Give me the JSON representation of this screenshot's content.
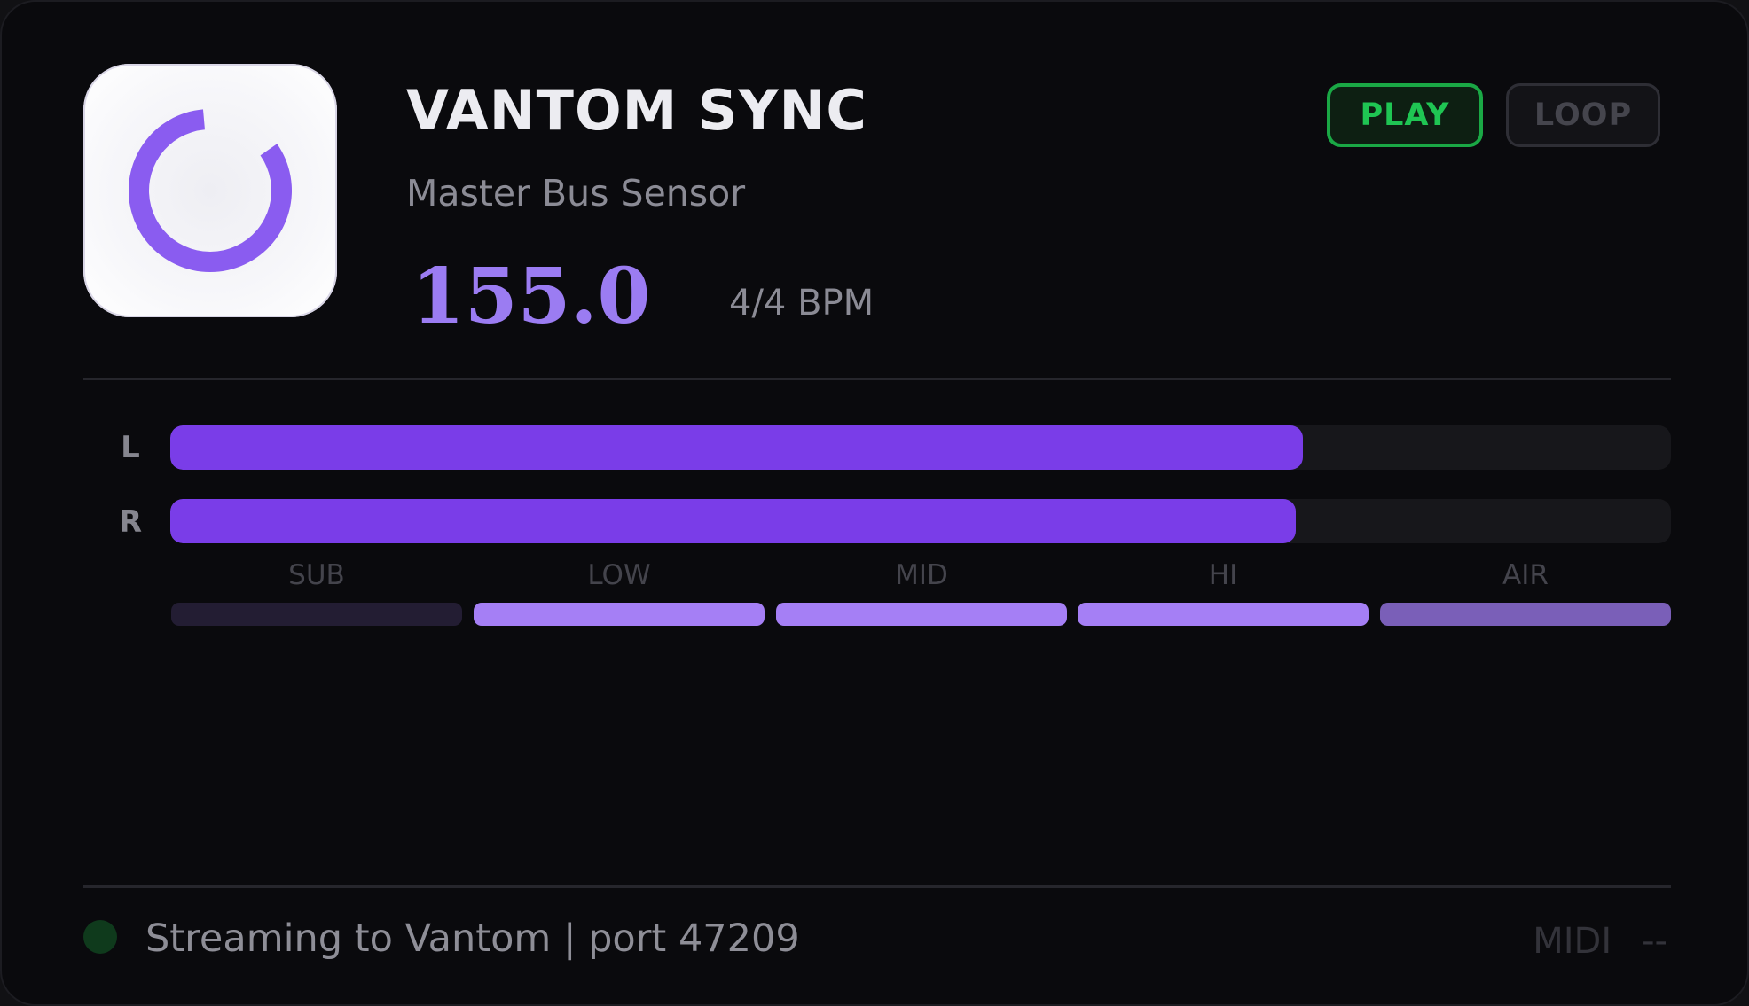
{
  "app": {
    "title": "VANTOM SYNC",
    "subtitle": "Master Bus Sensor",
    "icon": "vantom-ring-logo"
  },
  "tempo": {
    "bpm": "155.0",
    "unit": "4/4 BPM"
  },
  "transport": {
    "play_label": "PLAY",
    "loop_label": "LOOP",
    "play_active": true,
    "loop_active": false
  },
  "meters": {
    "left_label": "L",
    "right_label": "R",
    "left_level": 0.755,
    "right_level": 0.75,
    "fill_color": "#7a3de8"
  },
  "bands": [
    {
      "label": "SUB",
      "level": "low",
      "color": "#231d33"
    },
    {
      "label": "LOW",
      "level": "high",
      "color": "#a57ff5"
    },
    {
      "label": "MID",
      "level": "high",
      "color": "#a57ff5"
    },
    {
      "label": "HI",
      "level": "high",
      "color": "#a57ff5"
    },
    {
      "label": "AIR",
      "level": "medium",
      "color": "#7a5fb8"
    }
  ],
  "status": {
    "text": "Streaming to Vantom  |  port 47209",
    "indicator_color": "#0f3a1c",
    "midi_label": "MIDI",
    "midi_value": "--"
  },
  "colors": {
    "accent": "#9b7cf2",
    "play": "#1fc553",
    "background": "#0a0a0d"
  }
}
